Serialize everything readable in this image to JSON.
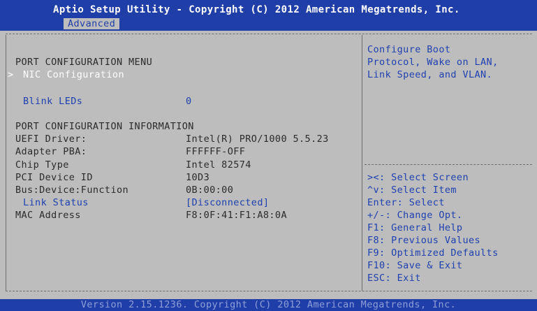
{
  "header": {
    "title": "Aptio Setup Utility - Copyright (C) 2012 American Megatrends, Inc.",
    "active_tab": "Advanced"
  },
  "main": {
    "menu_title": "PORT CONFIGURATION MENU",
    "selection_marker": ">",
    "nic_configuration": "NIC Configuration",
    "blink_leds": {
      "label": "Blink LEDs",
      "value": "0"
    },
    "info_title": "PORT CONFIGURATION INFORMATION",
    "info": [
      {
        "label": "UEFI Driver:",
        "value": "Intel(R) PRO/1000 5.5.23"
      },
      {
        "label": "Adapter PBA:",
        "value": "FFFFFF-OFF"
      },
      {
        "label": "Chip Type",
        "value": "Intel 82574"
      },
      {
        "label": "PCI Device ID",
        "value": "10D3"
      },
      {
        "label": "Bus:Device:Function",
        "value": "0B:00:00"
      },
      {
        "label": "Link Status",
        "value": "[Disconnected]"
      },
      {
        "label": "MAC Address",
        "value": "F8:0F:41:F1:A8:0A"
      }
    ]
  },
  "help": {
    "lines": [
      "Configure Boot",
      "Protocol, Wake on LAN,",
      "Link Speed, and VLAN."
    ]
  },
  "keys": [
    "><: Select Screen",
    "^v: Select Item",
    "Enter: Select",
    "+/-: Change Opt.",
    "F1: General Help",
    "F8: Previous Values",
    "F9: Optimized Defaults",
    "F10: Save & Exit",
    "ESC: Exit"
  ],
  "footer": {
    "version": "Version 2.15.1236. Copyright (C) 2012 American Megatrends, Inc."
  },
  "colors": {
    "header_blue": "#1f3ea8",
    "panel_gray": "#bdbdbd",
    "item_blue": "#2040b0",
    "text_dark": "#2b2b2b",
    "selected_white": "#ffffff"
  }
}
